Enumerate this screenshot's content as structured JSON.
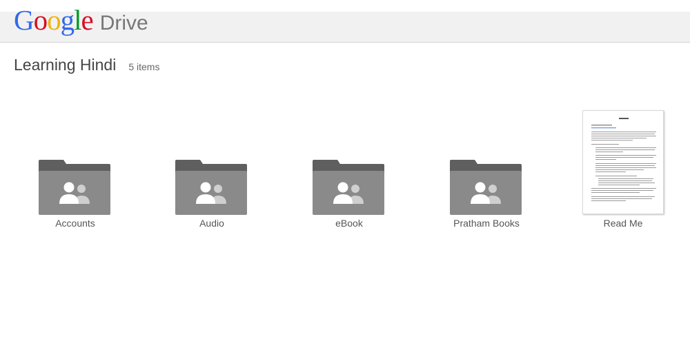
{
  "header": {
    "logo": {
      "letters": [
        {
          "char": "G",
          "color": "#3369e8"
        },
        {
          "char": "o",
          "color": "#d50f25"
        },
        {
          "char": "o",
          "color": "#eeb211"
        },
        {
          "char": "g",
          "color": "#3369e8"
        },
        {
          "char": "l",
          "color": "#009925"
        },
        {
          "char": "e",
          "color": "#d50f25"
        }
      ],
      "product": "Drive"
    }
  },
  "folder": {
    "title": "Learning Hindi",
    "count": "5 items"
  },
  "items": [
    {
      "name": "Accounts",
      "type": "shared-folder",
      "icon": "shared-folder-icon"
    },
    {
      "name": "Audio",
      "type": "shared-folder",
      "icon": "shared-folder-icon"
    },
    {
      "name": "eBook",
      "type": "shared-folder",
      "icon": "shared-folder-icon"
    },
    {
      "name": "Pratham Books",
      "type": "shared-folder",
      "icon": "shared-folder-icon"
    },
    {
      "name": "Read Me",
      "type": "document",
      "icon": "document-thumbnail"
    }
  ],
  "colors": {
    "folder_dark": "#5f5f5f",
    "folder_body": "#8a8a8a",
    "people_light": "#ffffff",
    "people_dim": "#cfcfcf"
  }
}
